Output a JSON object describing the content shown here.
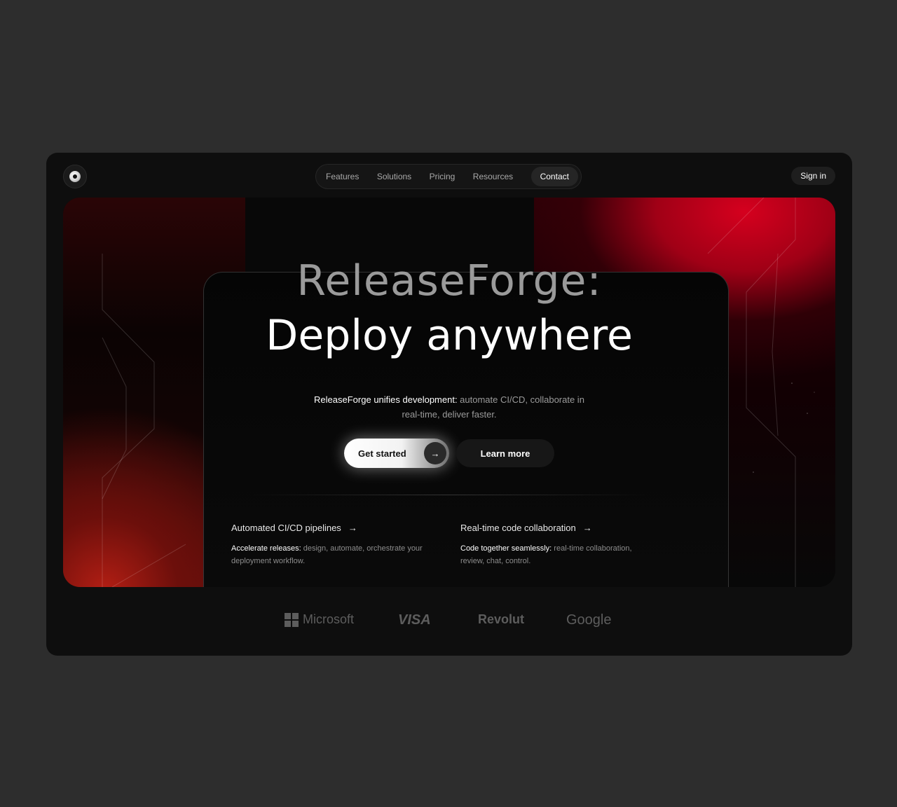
{
  "nav": {
    "items": [
      {
        "label": "Features",
        "active": false
      },
      {
        "label": "Solutions",
        "active": false
      },
      {
        "label": "Pricing",
        "active": false
      },
      {
        "label": "Resources",
        "active": false
      },
      {
        "label": "Contact",
        "active": true
      }
    ],
    "signin_label": "Sign in"
  },
  "hero": {
    "title_line1": "ReleaseForge:",
    "title_line2": "Deploy anywhere",
    "description_strong": "ReleaseForge unifies development:",
    "description_rest": " automate CI/CD, collaborate in real-time, deliver faster.",
    "primary_button": "Get started",
    "secondary_button": "Learn more"
  },
  "features": [
    {
      "title": "Automated CI/CD pipelines",
      "desc_strong": "Accelerate releases:",
      "desc_rest": " design, automate, orchestrate your deployment workflow."
    },
    {
      "title": "Real-time code collaboration",
      "desc_strong": "Code together seamlessly:",
      "desc_rest": " real-time collaboration, review, chat, control."
    }
  ],
  "brands": {
    "microsoft": "Microsoft",
    "visa": "VISA",
    "revolut": "Revolut",
    "google": "Google"
  },
  "colors": {
    "page_bg": "#2d2d2d",
    "frame_bg": "#0e0e0e",
    "accent_red": "#d5001e"
  }
}
